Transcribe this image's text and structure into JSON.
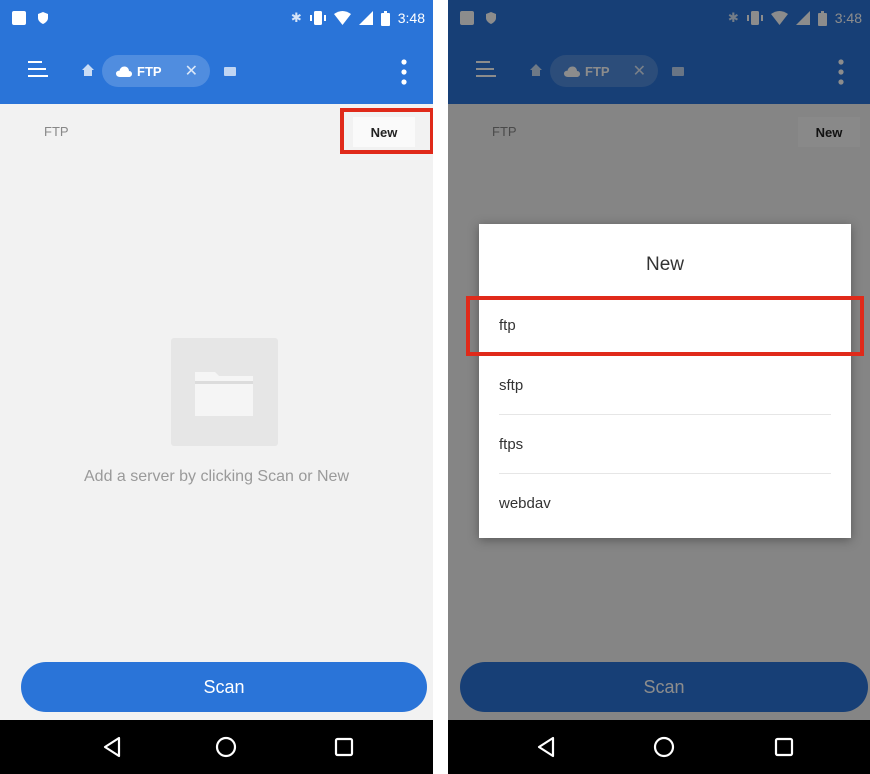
{
  "status_bar": {
    "time": "3:48"
  },
  "colors": {
    "primary": "#2a74d8",
    "highlight": "#e02a1a"
  },
  "app_bar": {
    "tab_label": "FTP",
    "tab_close": "✕"
  },
  "path": {
    "label": "FTP"
  },
  "actions": {
    "new_label": "New",
    "scan_label": "Scan"
  },
  "empty_state": {
    "message": "Add a server by clicking Scan or New"
  },
  "dialog": {
    "title": "New",
    "options": [
      "ftp",
      "sftp",
      "ftps",
      "webdav"
    ]
  },
  "icons": [
    "menu-icon",
    "home-icon",
    "cloud-icon",
    "window-icon",
    "more-icon",
    "back-icon",
    "home-circle-icon",
    "recents-icon",
    "bluetooth-icon",
    "vibrate-icon",
    "wifi-icon",
    "signal-icon",
    "battery-icon"
  ]
}
